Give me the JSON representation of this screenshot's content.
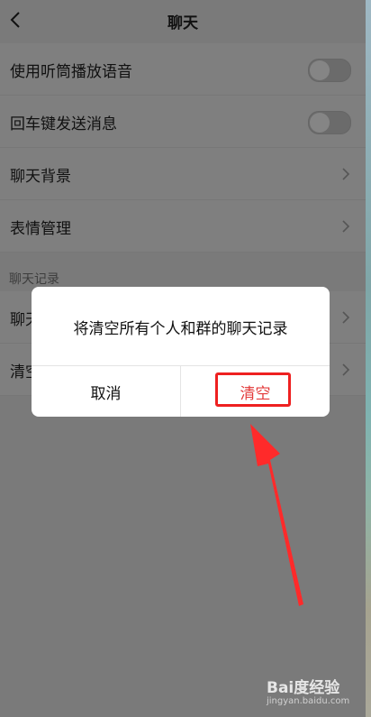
{
  "navbar": {
    "title": "聊天"
  },
  "settings": {
    "items": [
      {
        "label": "使用听筒播放语音",
        "control": "toggle"
      },
      {
        "label": "回车键发送消息",
        "control": "toggle"
      },
      {
        "label": "聊天背景",
        "control": "chevron"
      },
      {
        "label": "表情管理",
        "control": "chevron"
      }
    ]
  },
  "history": {
    "section_header": "聊天记录",
    "items": [
      {
        "label": "聊天"
      },
      {
        "label": "清空"
      }
    ]
  },
  "dialog": {
    "message": "将清空所有个人和群的聊天记录",
    "cancel_label": "取消",
    "confirm_label": "清空"
  },
  "watermark": {
    "logo": "Bai度经验",
    "url": "jingyan.baidu.com"
  },
  "colors": {
    "accent_red": "#ee2020",
    "confirm_text": "#e33b3b",
    "overlay": "#7a7a7a"
  }
}
